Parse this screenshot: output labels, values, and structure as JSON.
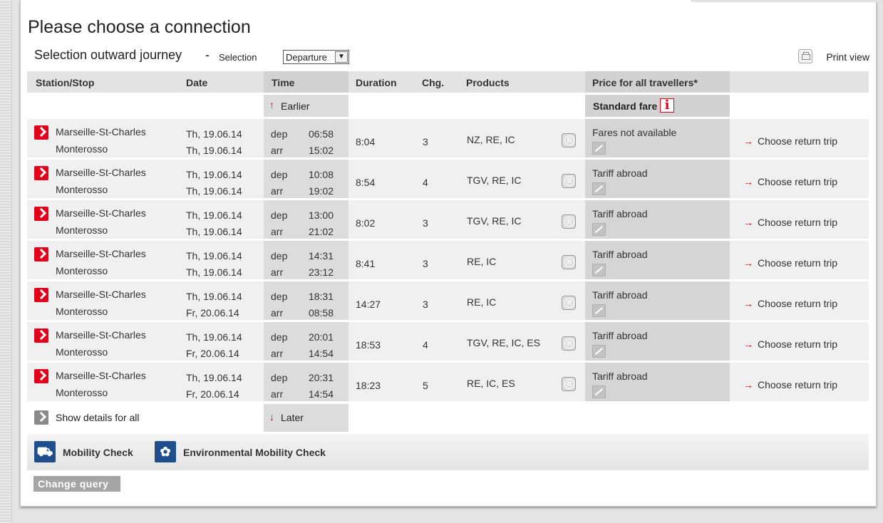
{
  "page": {
    "title": "Please choose a connection",
    "subtitle": "Selection outward journey",
    "separator": "-",
    "selection_label": "Selection",
    "selection_value": "Departure",
    "print_label": "Print view"
  },
  "table": {
    "headers": {
      "station": "Station/Stop",
      "date": "Date",
      "time": "Time",
      "duration": "Duration",
      "changes": "Chg.",
      "products": "Products",
      "price": "Price for all travellers*"
    },
    "earlier_label": "Earlier",
    "later_label": "Later",
    "standard_fare_label": "Standard fare",
    "dep_label": "dep",
    "arr_label": "arr",
    "choose_label": "Choose return trip",
    "show_details_label": "Show details for all",
    "rows": [
      {
        "from": "Marseille-St-Charles",
        "to": "Monterosso",
        "dep_date": "Th, 19.06.14",
        "arr_date": "Th, 19.06.14",
        "dep_time": "06:58",
        "arr_time": "15:02",
        "duration": "8:04",
        "changes": "3",
        "products": "NZ, RE, IC",
        "fare": "Fares not available"
      },
      {
        "from": "Marseille-St-Charles",
        "to": "Monterosso",
        "dep_date": "Th, 19.06.14",
        "arr_date": "Th, 19.06.14",
        "dep_time": "10:08",
        "arr_time": "19:02",
        "duration": "8:54",
        "changes": "4",
        "products": "TGV, RE, IC",
        "fare": "Tariff abroad"
      },
      {
        "from": "Marseille-St-Charles",
        "to": "Monterosso",
        "dep_date": "Th, 19.06.14",
        "arr_date": "Th, 19.06.14",
        "dep_time": "13:00",
        "arr_time": "21:02",
        "duration": "8:02",
        "changes": "3",
        "products": "TGV, RE, IC",
        "fare": "Tariff abroad"
      },
      {
        "from": "Marseille-St-Charles",
        "to": "Monterosso",
        "dep_date": "Th, 19.06.14",
        "arr_date": "Th, 19.06.14",
        "dep_time": "14:31",
        "arr_time": "23:12",
        "duration": "8:41",
        "changes": "3",
        "products": "RE, IC",
        "fare": "Tariff abroad"
      },
      {
        "from": "Marseille-St-Charles",
        "to": "Monterosso",
        "dep_date": "Th, 19.06.14",
        "arr_date": "Fr, 20.06.14",
        "dep_time": "18:31",
        "arr_time": "08:58",
        "duration": "14:27",
        "changes": "3",
        "products": "RE, IC",
        "fare": "Tariff abroad"
      },
      {
        "from": "Marseille-St-Charles",
        "to": "Monterosso",
        "dep_date": "Th, 19.06.14",
        "arr_date": "Fr, 20.06.14",
        "dep_time": "20:01",
        "arr_time": "14:54",
        "duration": "18:53",
        "changes": "4",
        "products": "TGV, RE, IC, ES",
        "fare": "Tariff abroad"
      },
      {
        "from": "Marseille-St-Charles",
        "to": "Monterosso",
        "dep_date": "Th, 19.06.14",
        "arr_date": "Fr, 20.06.14",
        "dep_time": "20:31",
        "arr_time": "14:54",
        "duration": "18:23",
        "changes": "5",
        "products": "RE, IC, ES",
        "fare": "Tariff abroad"
      }
    ]
  },
  "mobility": {
    "check_label": "Mobility Check",
    "env_check_label": "Environmental Mobility Check"
  },
  "actions": {
    "change_query_label": "Change query"
  },
  "icons": {
    "expand": "chevron-right-icon",
    "reservation": "reservation-icon",
    "fare": "fare-unavailable-icon",
    "info": "info-icon",
    "print": "printer-icon",
    "mobility": "mobility-icon",
    "environment": "flower-icon"
  },
  "colors": {
    "accent": "#e2001a",
    "header_bg": "#e3e3e3",
    "row_bg": "#f0f0f0",
    "button_bg": "#a5a5a5",
    "mobility_icon_bg": "#1f4e8c"
  }
}
